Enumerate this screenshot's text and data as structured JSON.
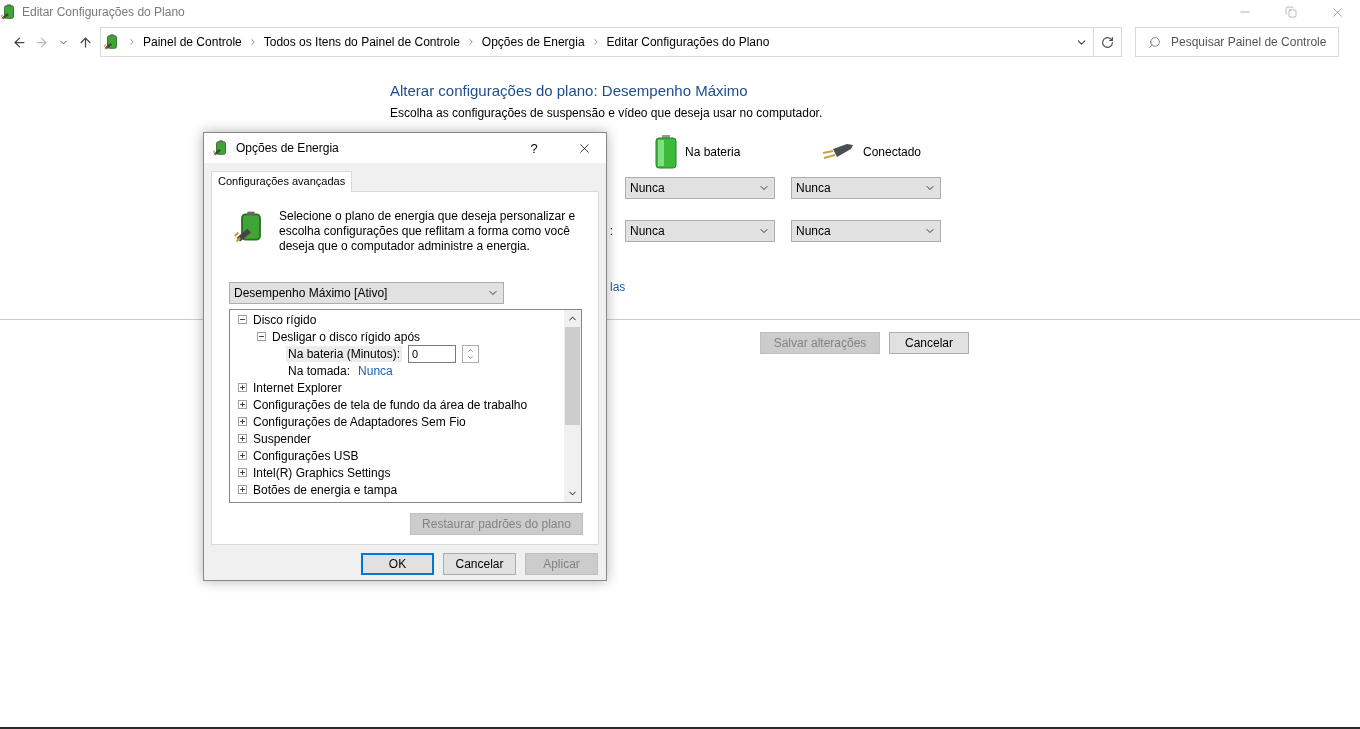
{
  "window": {
    "title": "Editar Configurações do Plano"
  },
  "address_bar": {
    "breadcrumbs": [
      "Painel de Controle",
      "Todos os Itens do Painel de Controle",
      "Opções de Energia",
      "Editar Configurações do Plano"
    ]
  },
  "search": {
    "placeholder": "Pesquisar Painel de Controle"
  },
  "plan": {
    "heading": "Alterar configurações do plano: Desempenho Máximo",
    "description": "Escolha as configurações de suspensão e vídeo que deseja usar no computador.",
    "columns": [
      {
        "kind": "battery",
        "label": "Na bateria"
      },
      {
        "kind": "plug",
        "label": "Conectado"
      }
    ],
    "rows": [
      {
        "values": [
          "Nunca",
          "Nunca"
        ]
      },
      {
        "label": ":",
        "values": [
          "Nunca",
          "Nunca"
        ]
      }
    ],
    "link": "las",
    "buttons": [
      {
        "label": "Salvar alterações",
        "disabled": true
      },
      {
        "label": "Cancelar",
        "disabled": false
      }
    ]
  },
  "dialog": {
    "title": "Opções de Energia",
    "help": "?",
    "tabs": [
      {
        "label": "Configurações avançadas",
        "selected": true
      }
    ],
    "intro": "Selecione o plano de energia que deseja personalizar e escolha configurações que reflitam a forma como você deseja que o computador administre a energia.",
    "plan_select": "Desempenho Máximo [Ativo]",
    "tree": [
      {
        "label": "Disco rígido",
        "expanded": true,
        "children": [
          {
            "label": "Desligar o disco rígido após",
            "expanded": true,
            "children": [
              {
                "kind": "spin",
                "label": "Na bateria (Minutos):",
                "value": "0",
                "selected": true
              },
              {
                "kind": "link",
                "label": "Na tomada:",
                "value": "Nunca",
                "selected": false
              }
            ]
          }
        ]
      },
      {
        "label": "Internet Explorer",
        "expanded": false
      },
      {
        "label": "Configurações de tela de fundo da área de trabalho",
        "expanded": false
      },
      {
        "label": "Configurações de Adaptadores Sem Fio",
        "expanded": false
      },
      {
        "label": "Suspender",
        "expanded": false
      },
      {
        "label": "Configurações USB",
        "expanded": false
      },
      {
        "label": "Intel(R) Graphics Settings",
        "expanded": false
      },
      {
        "label": "Botões de energia e tampa",
        "expanded": false
      }
    ],
    "restore_button": {
      "label": "Restaurar padrões do plano",
      "disabled": true
    },
    "buttons": [
      {
        "label": "OK",
        "disabled": false,
        "default": true
      },
      {
        "label": "Cancelar",
        "disabled": false,
        "default": false
      },
      {
        "label": "Aplicar",
        "disabled": true,
        "default": false
      }
    ]
  }
}
